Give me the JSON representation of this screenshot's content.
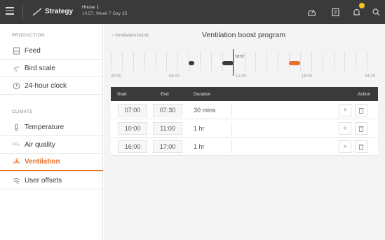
{
  "header": {
    "app_label": "Strategy",
    "house": "House 1",
    "house_subtitle": "10:57, Week 7 Day 35",
    "icons": [
      "menu-icon",
      "strategy-icon",
      "dashboard-icon",
      "notes-icon",
      "bell-icon",
      "search-icon"
    ],
    "badge_color": "#f5c518"
  },
  "sidebar": {
    "sections": [
      {
        "heading": "PRODUCTION",
        "items": [
          {
            "label": "Feed",
            "icon": "feed-icon"
          },
          {
            "label": "Bird scale",
            "icon": "bird-scale-icon"
          },
          {
            "label": "24-hour clock",
            "icon": "clock-icon"
          }
        ]
      },
      {
        "heading": "CLIMATE",
        "items": [
          {
            "label": "Temperature",
            "icon": "thermometer-icon"
          },
          {
            "label": "Air quality",
            "icon": "co2-icon",
            "icon_text": "CO₂"
          },
          {
            "label": "Ventilation",
            "icon": "fan-icon",
            "active": true
          },
          {
            "label": "User offsets",
            "icon": "offsets-icon"
          }
        ]
      }
    ]
  },
  "main": {
    "breadcrumb": "‹ Ventilation boost",
    "title": "Ventilation boost program",
    "timeline": {
      "ticks": [
        "00:00",
        "06:00",
        "12:00",
        "18:00",
        "24:00"
      ],
      "now_label": "10:57",
      "now_hour": 10.95,
      "events": [
        {
          "start_hour": 7.0,
          "end_hour": 7.5,
          "color": "#3a3a3a"
        },
        {
          "start_hour": 10.0,
          "end_hour": 11.0,
          "color": "#3a3a3a"
        },
        {
          "start_hour": 16.0,
          "end_hour": 17.0,
          "color": "#e8702a"
        }
      ]
    },
    "table": {
      "headers": {
        "start": "Start",
        "end": "End",
        "duration": "Duration",
        "action": "Action"
      },
      "rows": [
        {
          "start": "07:00",
          "end": "07:30",
          "duration": "30 mins"
        },
        {
          "start": "10:00",
          "end": "11:00",
          "duration": "1 hr"
        },
        {
          "start": "16:00",
          "end": "17:00",
          "duration": "1 hr"
        }
      ]
    }
  },
  "colors": {
    "accent": "#e8702a",
    "topbar": "#3a3a3a"
  }
}
